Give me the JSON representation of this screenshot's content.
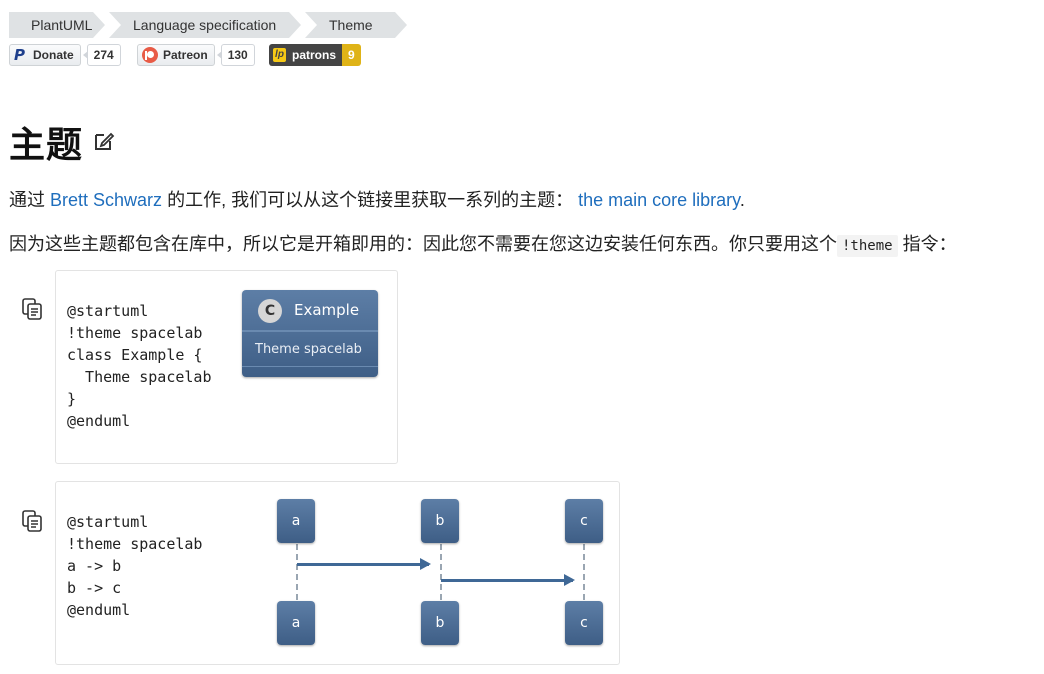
{
  "breadcrumb": [
    "PlantUML",
    "Language specification",
    "Theme"
  ],
  "badges": {
    "donate": {
      "label": "Donate",
      "count": "274"
    },
    "patreon": {
      "label": "Patreon",
      "count": "130"
    },
    "liberapay": {
      "label": "patrons",
      "count": "9"
    }
  },
  "title": "主题",
  "para1": {
    "prefix": "通过 ",
    "author_link": "Brett Schwarz",
    "middle": " 的工作, 我们可以从这个链接里获取一系列的主题： ",
    "library_link": "the main core library",
    "suffix": "."
  },
  "para2": {
    "prefix": "因为这些主题都包含在库中，所以它是开箱即用的：因此您不需要在您这边安装任何东西。你只要用这个",
    "code": "!theme",
    "suffix": " 指令："
  },
  "example1": {
    "code": "@startuml\n!theme spacelab\nclass Example {\n  Theme spacelab\n}\n@enduml",
    "diagram": {
      "class_letter": "C",
      "class_name": "Example",
      "attribute": "Theme spacelab"
    }
  },
  "example2": {
    "code": "@startuml\n!theme spacelab\na -> b\nb -> c\n@enduml",
    "participants": [
      "a",
      "b",
      "c"
    ]
  }
}
